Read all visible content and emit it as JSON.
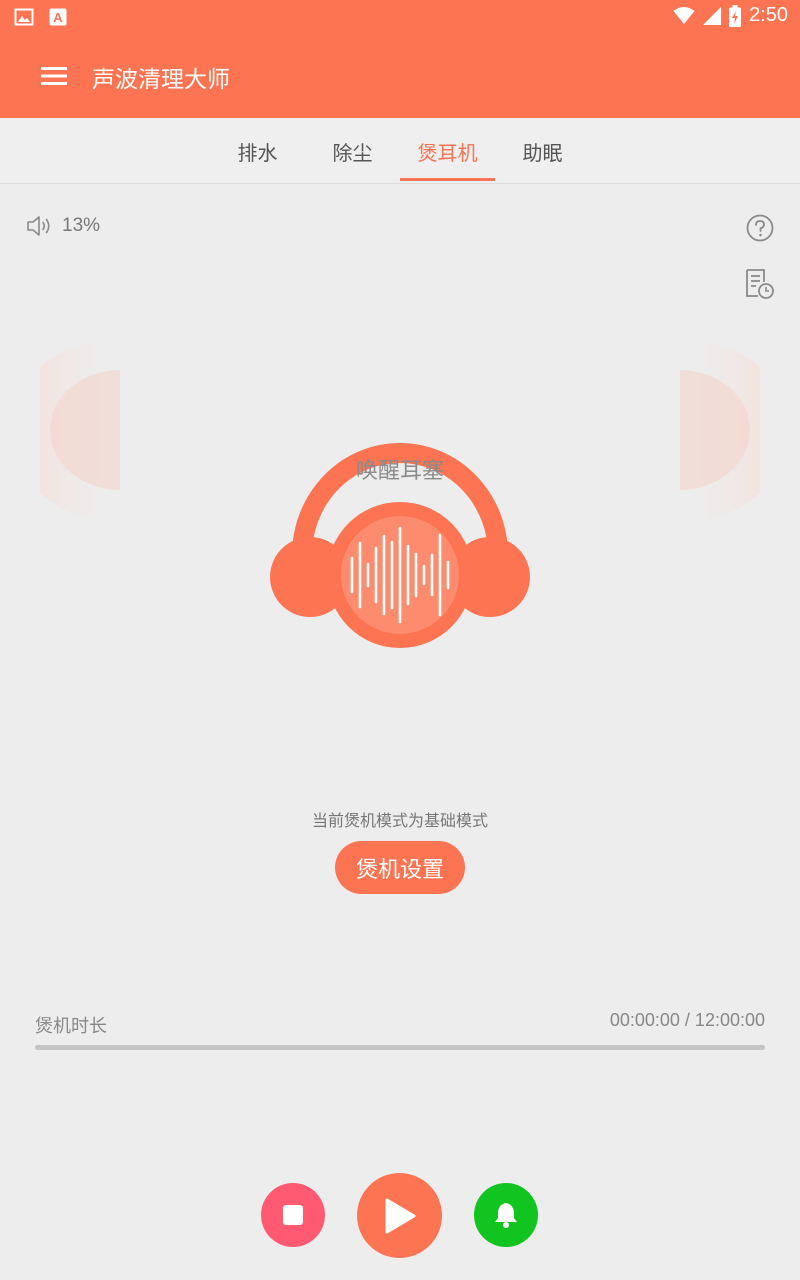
{
  "status_bar": {
    "time": "2:50"
  },
  "app_bar": {
    "title": "声波清理大师"
  },
  "tabs": [
    {
      "label": "排水",
      "active": false
    },
    {
      "label": "除尘",
      "active": false
    },
    {
      "label": "煲耳机",
      "active": true
    },
    {
      "label": "助眠",
      "active": false
    }
  ],
  "volume": {
    "value": "13%"
  },
  "headphone": {
    "label": "唤醒耳塞"
  },
  "mode": {
    "text": "当前煲机模式为基础模式",
    "settings_label": "煲机设置"
  },
  "duration": {
    "label": "煲机时长",
    "value": "00:00:00 / 12:00:00",
    "progress": 0
  },
  "colors": {
    "accent": "#FC7452",
    "stop": "#FF5A72",
    "bell": "#12C420",
    "background": "#EDEDED"
  }
}
